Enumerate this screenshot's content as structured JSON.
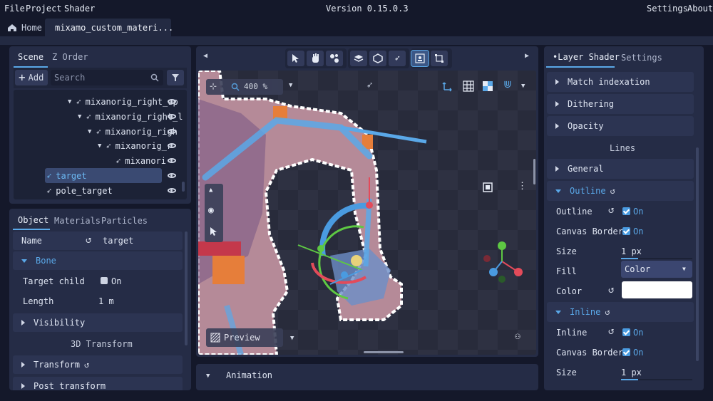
{
  "menubar": {
    "file": "File",
    "project": "Project",
    "shader": "Shader",
    "version": "Version 0.15.0.3",
    "settings": "Settings",
    "about": "About"
  },
  "tabs": {
    "home": "Home",
    "document": "mixamo_custom_materi..."
  },
  "scene": {
    "tab_scene": "Scene",
    "tab_zorder": "Z Order",
    "add_label": "Add",
    "search_placeholder": "Search",
    "items": [
      "mixanorig_right_up",
      "mixanorig_right_l",
      "mixanorig_righ",
      "mixanorig_r",
      "mixanori",
      "target",
      "pole_target"
    ]
  },
  "object": {
    "tab_object": "Object",
    "tab_materials": "Materials",
    "tab_particles": "Particles",
    "name_label": "Name",
    "name_value": "target",
    "bone_section": "Bone",
    "target_child_label": "Target child",
    "target_child_value": "On",
    "length_label": "Length",
    "length_value": "1 m",
    "visibility_section": "Visibility",
    "transform3d_header": "3D Transform",
    "transform_section": "Transform",
    "post_transform_section": "Post transform"
  },
  "viewport": {
    "zoom": "400 %",
    "preview_label": "Preview"
  },
  "animation": {
    "label": "Animation"
  },
  "layer": {
    "tab_layer_shader": "Layer Shader",
    "tab_settings": "Settings",
    "match_indexation": "Match indexation",
    "dithering": "Dithering",
    "opacity": "Opacity",
    "lines_header": "Lines",
    "general": "General",
    "outline_section": "Outline",
    "outline_label": "Outline",
    "outline_value": "On",
    "canvas_border_label": "Canvas Border",
    "canvas_border_value": "On",
    "size_label": "Size",
    "size_value": "1 px",
    "fill_label": "Fill",
    "fill_value": "Color",
    "color_label": "Color",
    "color_value": "#ffffff",
    "inline_section": "Inline",
    "inline_label": "Inline",
    "inline_value": "On",
    "inline_canvas_border_label": "Canvas Border",
    "inline_canvas_border_value": "On",
    "inline_size_label": "Size",
    "inline_size_value": "1 px"
  },
  "colors": {
    "accent": "#5aa8e8",
    "bg": "#14182a",
    "panel": "#252c46",
    "axis_x": "#e34b5a",
    "axis_y": "#5ec843",
    "axis_z": "#4a9be0"
  }
}
